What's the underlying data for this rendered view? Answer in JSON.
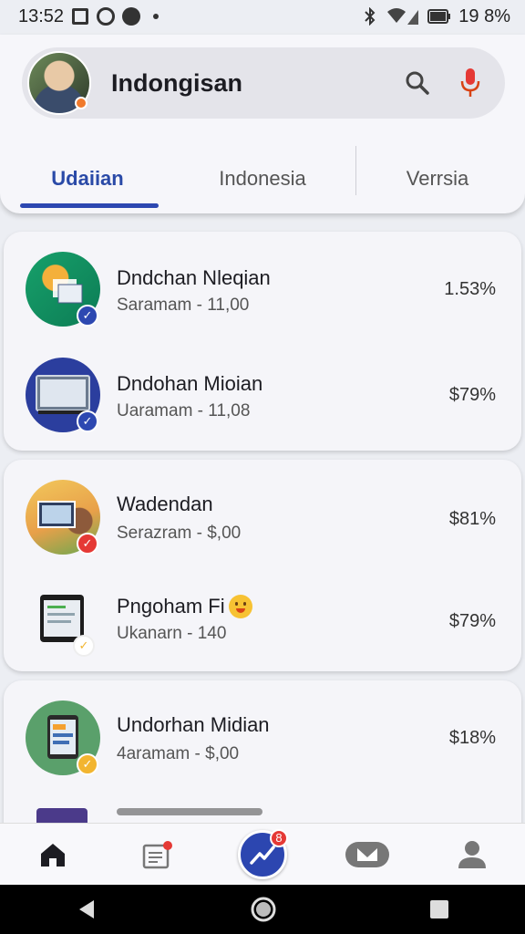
{
  "status_bar": {
    "time": "13:52",
    "battery": "19 8%"
  },
  "header": {
    "title": "Indongisan"
  },
  "tabs": [
    {
      "label": "Udaiian",
      "active": true
    },
    {
      "label": "Indonesia",
      "active": false
    },
    {
      "label": "Verrsia",
      "active": false
    }
  ],
  "items": [
    {
      "title": "Dndchan Nleqian",
      "subtitle": "Saramam - 11,00",
      "value": "1.53%"
    },
    {
      "title": "Dndohan Mioian",
      "subtitle": "Uaramam - 11,08",
      "value": "$79%"
    },
    {
      "title": "Wadendan",
      "subtitle": "Serazram - $,00",
      "value": "$81%"
    },
    {
      "title": "Pngoham Fi",
      "subtitle": "Ukanarn - 140",
      "value": "$79%"
    },
    {
      "title": "Undorhan Midian",
      "subtitle": "4aramam - $,00",
      "value": "$18%"
    }
  ],
  "nav": {
    "fab_badge": "8"
  },
  "colors": {
    "accent": "#2d48b1",
    "badge_red": "#e53935",
    "badge_yellow": "#f2b530"
  }
}
